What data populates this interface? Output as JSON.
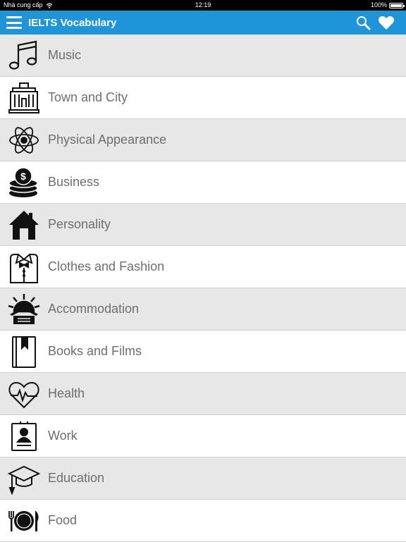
{
  "status_bar": {
    "carrier": "Nhà cung cấp",
    "time": "12:19",
    "battery": "100%"
  },
  "app_bar": {
    "title": "IELTS Vocabulary",
    "accent_color": "#1f95d8"
  },
  "topics": [
    {
      "label": "Music",
      "icon": "music-note-icon"
    },
    {
      "label": "Town and City",
      "icon": "building-icon"
    },
    {
      "label": "Physical Appearance",
      "icon": "atom-icon"
    },
    {
      "label": "Business",
      "icon": "coin-stack-icon"
    },
    {
      "label": "Personality",
      "icon": "house-icon"
    },
    {
      "label": "Clothes and Fashion",
      "icon": "shirt-bowtie-icon"
    },
    {
      "label": "Accommodation",
      "icon": "sunrise-hut-icon"
    },
    {
      "label": "Books and Films",
      "icon": "book-icon"
    },
    {
      "label": "Health",
      "icon": "heartbeat-icon"
    },
    {
      "label": "Work",
      "icon": "id-card-icon"
    },
    {
      "label": "Education",
      "icon": "graduation-cap-icon"
    },
    {
      "label": "Food",
      "icon": "plate-cutlery-icon"
    }
  ]
}
